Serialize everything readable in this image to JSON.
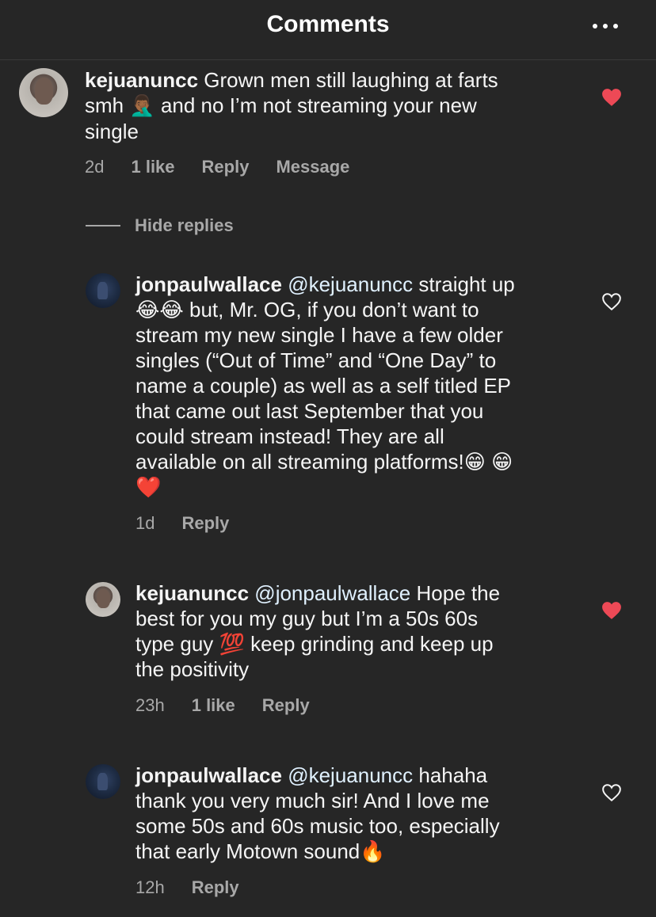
{
  "header": {
    "title": "Comments",
    "more_icon": "more-horizontal-icon"
  },
  "comments": [
    {
      "username": "kejuanuncc",
      "mention": "",
      "text_line1": "Grown men still laughing at farts",
      "text_line2_a": "smh ",
      "text_line2_emoji": "🤦🏾‍♂️",
      "text_line2_b": " and no I’m not streaming your new",
      "text_line3": "single",
      "time": "2d",
      "likes": "1 like",
      "reply": "Reply",
      "message": "Message",
      "liked": true
    },
    {
      "username": "jonpaulwallace",
      "mention": "@kejuanuncc",
      "text_line1": "straight up",
      "text_line2": "😂😂 but, Mr. OG, if you don’t want to",
      "text_line3": "stream my new single I have a few older",
      "text_line4": "singles (“Out of Time” and “One Day” to",
      "text_line5": "name a couple) as well as a self titled EP",
      "text_line6": "that came out last September that you",
      "text_line7": "could stream instead! They are all",
      "text_line8": "available on all streaming platforms!😁 😁",
      "text_line9": "❤️",
      "time": "1d",
      "reply": "Reply",
      "liked": false
    },
    {
      "username": "kejuanuncc",
      "mention": "@jonpaulwallace",
      "text_line1": "Hope the",
      "text_line2": "best for you my guy but I’m a 50s 60s",
      "text_line3": "type guy 💯 keep grinding and keep up",
      "text_line4": "the positivity",
      "time": "23h",
      "likes": "1 like",
      "reply": "Reply",
      "liked": true
    },
    {
      "username": "jonpaulwallace",
      "mention": "@kejuanuncc",
      "text_line1": "hahaha",
      "text_line2": "thank you very much sir! And I love me",
      "text_line3": "some 50s and 60s music too, especially",
      "text_line4": "that early Motown sound🔥",
      "time": "12h",
      "reply": "Reply",
      "liked": false
    }
  ],
  "hide_replies": "Hide replies",
  "colors": {
    "background": "#262626",
    "heart_liked": "#ed4956",
    "secondary_text": "#a8a8a8",
    "mention": "#e0f1ff"
  }
}
